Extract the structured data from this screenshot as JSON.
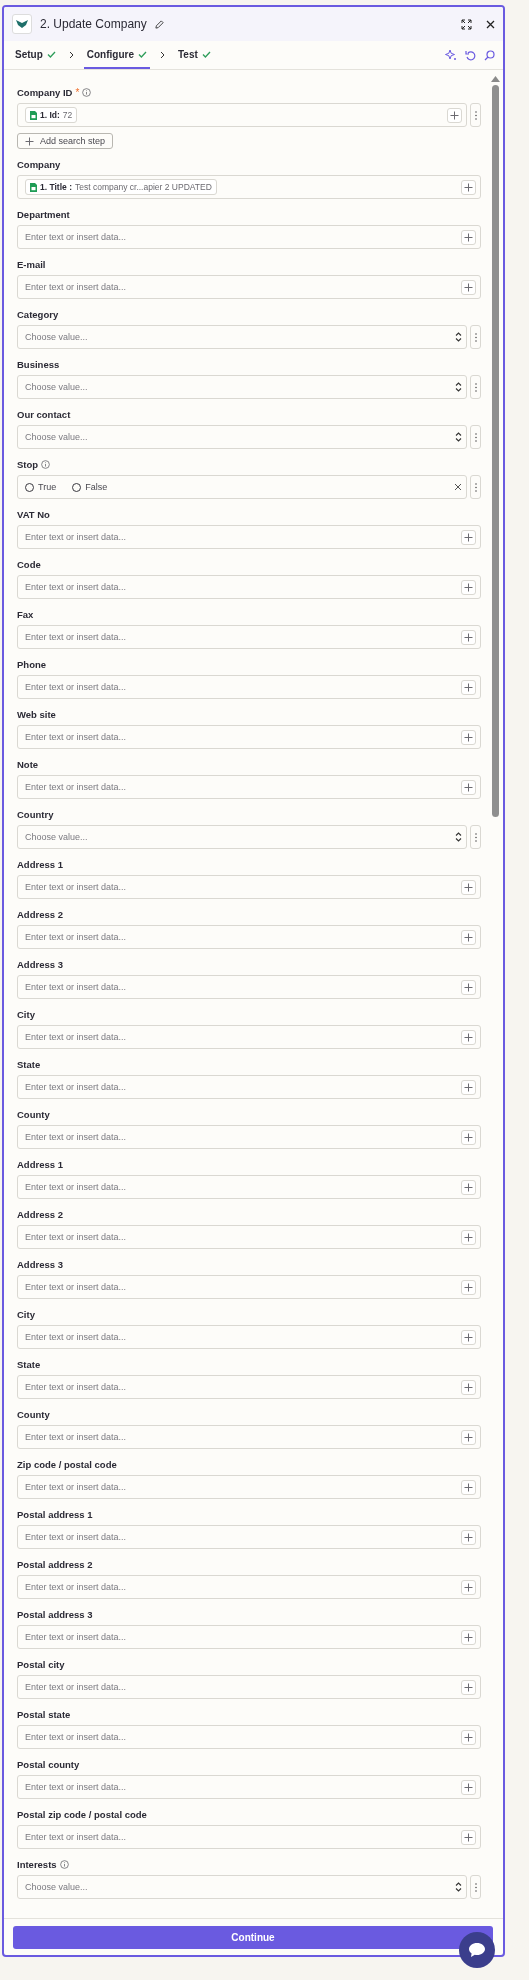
{
  "header": {
    "title": "2. Update Company"
  },
  "tabs": [
    {
      "label": "Setup",
      "done": true,
      "selected": false
    },
    {
      "label": "Configure",
      "done": true,
      "selected": true
    },
    {
      "label": "Test",
      "done": true,
      "selected": false
    }
  ],
  "fields": [
    {
      "label": "Company ID",
      "kind": "token",
      "required_mark": "*",
      "info": true,
      "menu": true,
      "token": "1. Id:",
      "value": "72",
      "add_step": "Add search step"
    },
    {
      "label": "Company",
      "kind": "token",
      "info": false,
      "menu": false,
      "token": "1. Title :",
      "value": "Test company cr...apier 2 UPDATED"
    },
    {
      "label": "Department",
      "kind": "text",
      "placeholder": "Enter text or insert data..."
    },
    {
      "label": "E-mail",
      "kind": "text",
      "placeholder": "Enter text or insert data..."
    },
    {
      "label": "Category",
      "kind": "select",
      "placeholder": "Choose value..."
    },
    {
      "label": "Business",
      "kind": "select",
      "placeholder": "Choose value..."
    },
    {
      "label": "Our contact",
      "kind": "select",
      "placeholder": "Choose value..."
    },
    {
      "label": "Stop",
      "kind": "radio",
      "info": true,
      "options": [
        {
          "label": "True",
          "selected": false
        },
        {
          "label": "False",
          "selected": false
        }
      ]
    },
    {
      "label": "VAT No",
      "kind": "text",
      "placeholder": "Enter text or insert data..."
    },
    {
      "label": "Code",
      "kind": "text",
      "placeholder": "Enter text or insert data..."
    },
    {
      "label": "Fax",
      "kind": "text",
      "placeholder": "Enter text or insert data..."
    },
    {
      "label": "Phone",
      "kind": "text",
      "placeholder": "Enter text or insert data..."
    },
    {
      "label": "Web site",
      "kind": "text",
      "placeholder": "Enter text or insert data..."
    },
    {
      "label": "Note",
      "kind": "text",
      "placeholder": "Enter text or insert data..."
    },
    {
      "label": "Country",
      "kind": "select",
      "placeholder": "Choose value..."
    },
    {
      "label": "Address 1",
      "kind": "text",
      "placeholder": "Enter text or insert data..."
    },
    {
      "label": "Address 2",
      "kind": "text",
      "placeholder": "Enter text or insert data..."
    },
    {
      "label": "Address 3",
      "kind": "text",
      "placeholder": "Enter text or insert data..."
    },
    {
      "label": "City",
      "kind": "text",
      "placeholder": "Enter text or insert data..."
    },
    {
      "label": "State",
      "kind": "text",
      "placeholder": "Enter text or insert data..."
    },
    {
      "label": "County",
      "kind": "text",
      "placeholder": "Enter text or insert data..."
    },
    {
      "label": "Address 1",
      "kind": "text",
      "placeholder": "Enter text or insert data..."
    },
    {
      "label": "Address 2",
      "kind": "text",
      "placeholder": "Enter text or insert data..."
    },
    {
      "label": "Address 3",
      "kind": "text",
      "placeholder": "Enter text or insert data..."
    },
    {
      "label": "City",
      "kind": "text",
      "placeholder": "Enter text or insert data..."
    },
    {
      "label": "State",
      "kind": "text",
      "placeholder": "Enter text or insert data..."
    },
    {
      "label": "County",
      "kind": "text",
      "placeholder": "Enter text or insert data..."
    },
    {
      "label": "Zip code / postal code",
      "kind": "text",
      "placeholder": "Enter text or insert data..."
    },
    {
      "label": "Postal address 1",
      "kind": "text",
      "placeholder": "Enter text or insert data..."
    },
    {
      "label": "Postal address 2",
      "kind": "text",
      "placeholder": "Enter text or insert data..."
    },
    {
      "label": "Postal address 3",
      "kind": "text",
      "placeholder": "Enter text or insert data..."
    },
    {
      "label": "Postal city",
      "kind": "text",
      "placeholder": "Enter text or insert data..."
    },
    {
      "label": "Postal state",
      "kind": "text",
      "placeholder": "Enter text or insert data..."
    },
    {
      "label": "Postal county",
      "kind": "text",
      "placeholder": "Enter text or insert data..."
    },
    {
      "label": "Postal zip code / postal code",
      "kind": "text",
      "placeholder": "Enter text or insert data..."
    },
    {
      "label": "Interests",
      "kind": "select",
      "info": true,
      "placeholder": "Choose value..."
    }
  ],
  "footer": {
    "button": "Continue"
  }
}
